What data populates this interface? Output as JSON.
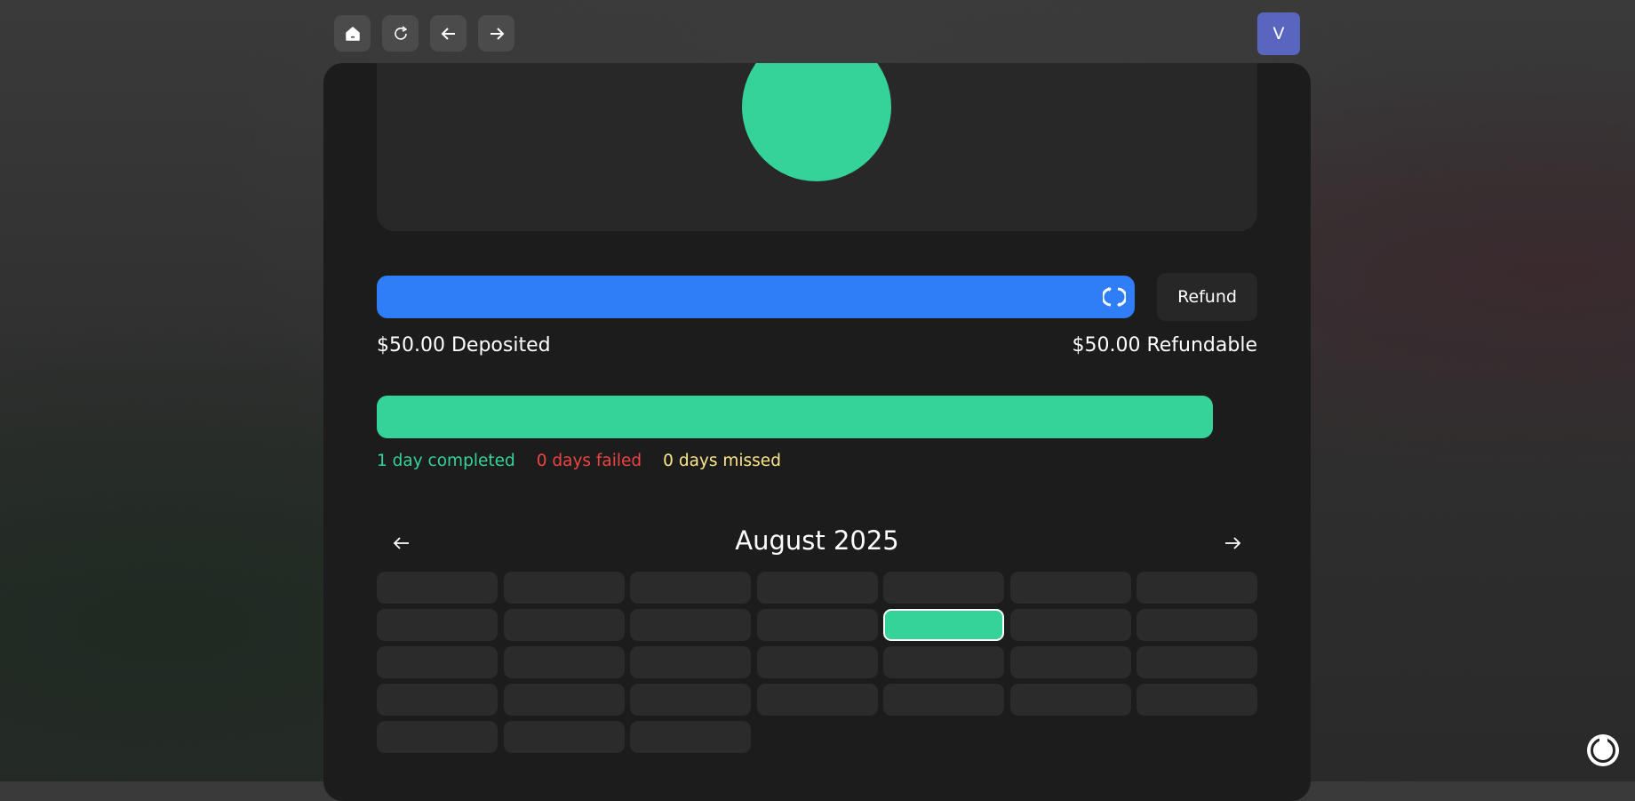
{
  "toolbar": {
    "avatar_letter": "V",
    "buttons": [
      "home",
      "refresh",
      "back",
      "forward"
    ]
  },
  "deposit": {
    "deposited_label": "$50.00 Deposited",
    "refundable_label": "$50.00 Refundable",
    "refund_button": "Refund",
    "slider_fraction": 1.0
  },
  "progress": {
    "fraction": 0.95,
    "completed": "1 day completed",
    "failed": "0 days failed",
    "missed": "0 days missed"
  },
  "calendar": {
    "month_label": "August 2025",
    "day_count": 31,
    "active_index": 11
  },
  "colors": {
    "accent_green": "#35d399",
    "accent_blue": "#2f7df7",
    "failed_red": "#ef4444",
    "missed_yellow": "#fde68a",
    "avatar_purple": "#5966c0"
  }
}
